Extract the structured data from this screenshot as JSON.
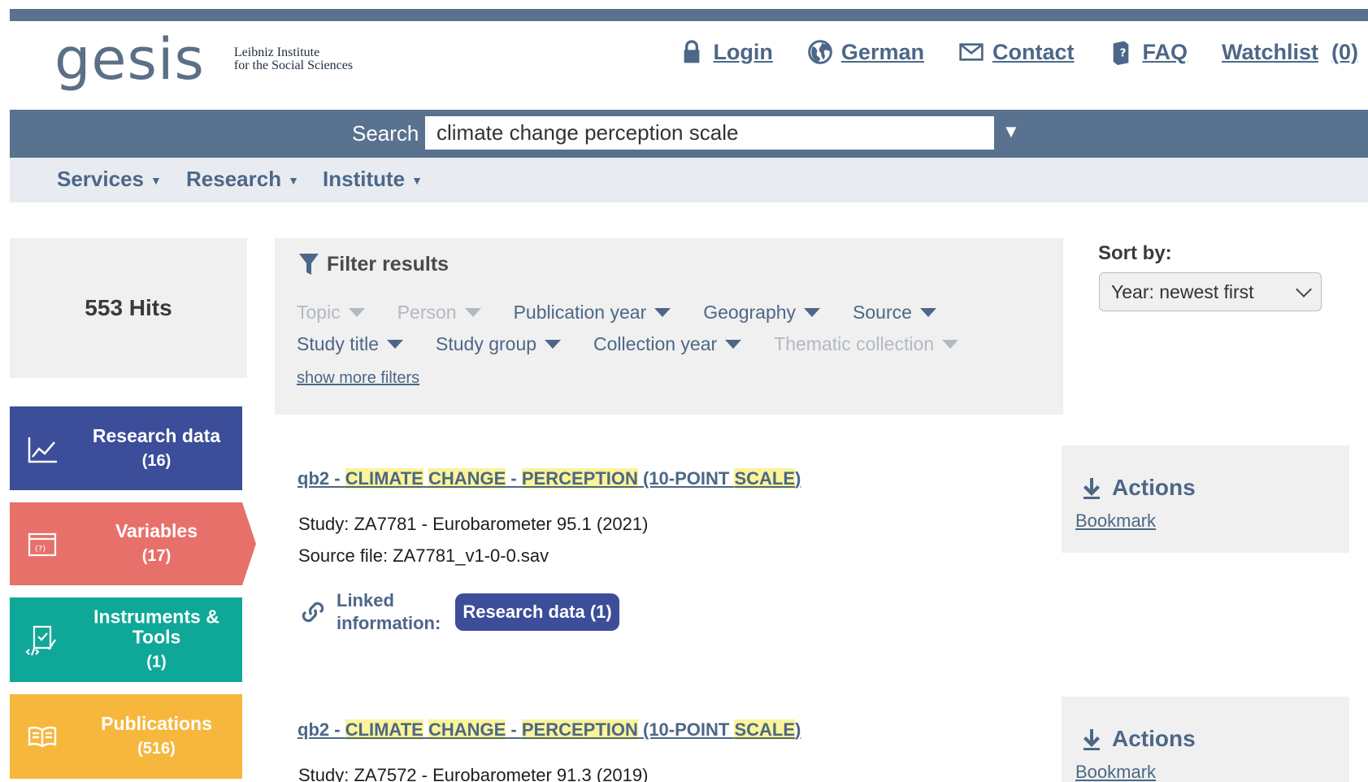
{
  "header": {
    "logo_text": "gesis",
    "logo_tagline_line1": "Leibniz Institute",
    "logo_tagline_line2": "for the Social Sciences",
    "login": "Login",
    "language": "German",
    "contact": "Contact",
    "faq": "FAQ",
    "watchlist": "Watchlist",
    "watchlist_count": "(0)"
  },
  "search": {
    "label": "Search",
    "value": "climate change perception scale",
    "toggle": "▼"
  },
  "nav": {
    "items": [
      {
        "label": "Services"
      },
      {
        "label": "Research"
      },
      {
        "label": "Institute"
      }
    ]
  },
  "hits": "553 Hits",
  "categories": [
    {
      "label": "Research data",
      "count": "(16)",
      "icon": "chart-line-icon",
      "color": "#3c4d9a"
    },
    {
      "label": "Variables",
      "count": "(17)",
      "icon": "variable-icon",
      "color": "#e8706b"
    },
    {
      "label": "Instruments & Tools",
      "count": "(1)",
      "icon": "clipboard-code-icon",
      "color": "#0fa898"
    },
    {
      "label": "Publications",
      "count": "(516)",
      "icon": "book-icon",
      "color": "#f6b73c"
    }
  ],
  "filters": {
    "title": "Filter results",
    "row1": [
      {
        "label": "Topic",
        "enabled": false
      },
      {
        "label": "Person",
        "enabled": false
      },
      {
        "label": "Publication year",
        "enabled": true
      },
      {
        "label": "Geography",
        "enabled": true
      },
      {
        "label": "Source",
        "enabled": true
      }
    ],
    "row2": [
      {
        "label": "Study title",
        "enabled": true
      },
      {
        "label": "Study group",
        "enabled": true
      },
      {
        "label": "Collection year",
        "enabled": true
      },
      {
        "label": "Thematic collection",
        "enabled": false
      }
    ],
    "show_more": "show more filters"
  },
  "sort": {
    "label": "Sort by:",
    "selected": "Year: newest first"
  },
  "results": [
    {
      "title_parts": [
        "qb2 - ",
        "CLIMATE",
        " ",
        "CHANGE",
        " - ",
        "PERCEPTION",
        " (10-POINT ",
        "SCALE",
        ")"
      ],
      "study": "Study: ZA7781 - Eurobarometer 95.1 (2021)",
      "source_file": "Source file: ZA7781_v1-0-0.sav",
      "linked_label_1": "Linked",
      "linked_label_2": "information:",
      "linked_button": "Research data (1)",
      "actions": "Actions",
      "bookmark": "Bookmark"
    },
    {
      "title_parts": [
        "qb2 - ",
        "CLIMATE",
        " ",
        "CHANGE",
        " - ",
        "PERCEPTION",
        " (10-POINT ",
        "SCALE",
        ")"
      ],
      "study": "Study: ZA7572 - Eurobarometer 91.3 (2019)",
      "actions": "Actions",
      "bookmark": "Bookmark"
    }
  ],
  "colors": {
    "brand": "#58728f",
    "link": "#4c6787",
    "highlight": "#fbf49a"
  }
}
